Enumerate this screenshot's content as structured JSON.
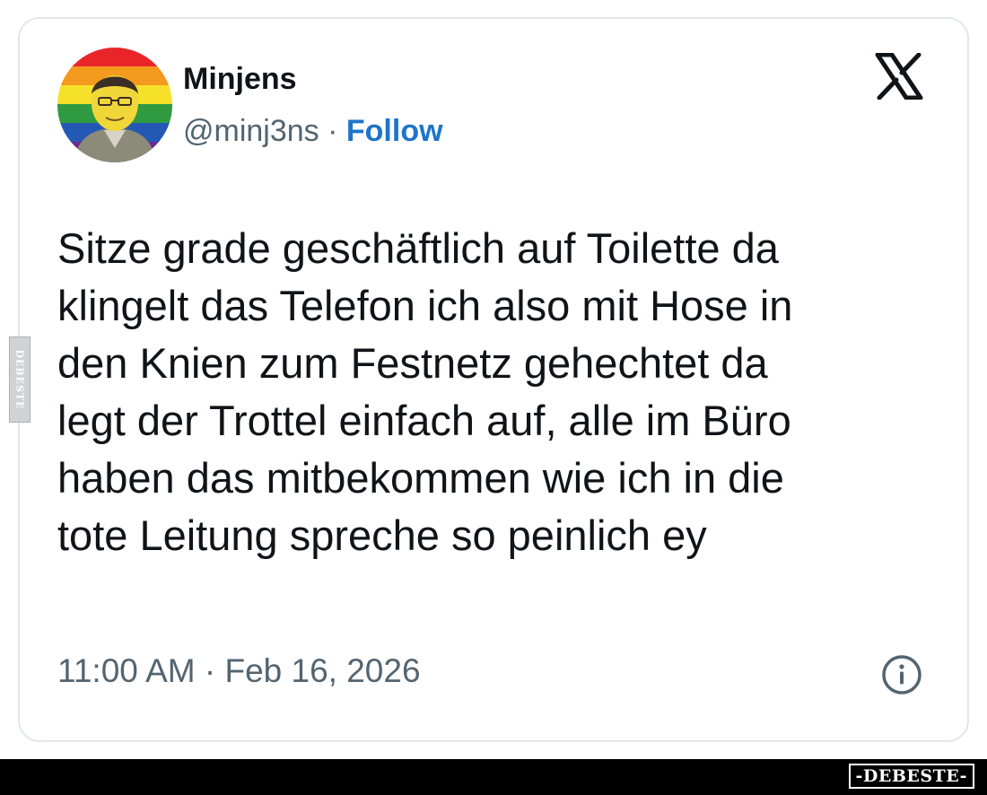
{
  "tweet": {
    "author_name": "Minjens",
    "handle": "@minj3ns",
    "separator": " · ",
    "follow_label": "Follow",
    "text_lines": [
      "Sitze grade geschäftlich auf Toilette da",
      "klingelt das Telefon ich also mit Hose in",
      "den Knien zum Festnetz gehechtet da",
      "legt der Trottel einfach auf, alle im Büro",
      "haben das mitbekommen wie ich in die",
      "tote Leitung spreche so peinlich ey"
    ],
    "timestamp": "11:00 AM · Feb 16, 2026"
  },
  "icons": {
    "logo": "x-logo-icon",
    "info": "info-icon",
    "avatar": "avatar-rainbow-portrait"
  },
  "watermark": {
    "side_label": "DEBESTE",
    "footer_label": "-DEBESTE-"
  },
  "colors": {
    "text": "#0f1419",
    "secondary": "#536471",
    "follow": "#1d75c9",
    "border": "#e3e7ea",
    "footer": "#000000"
  }
}
